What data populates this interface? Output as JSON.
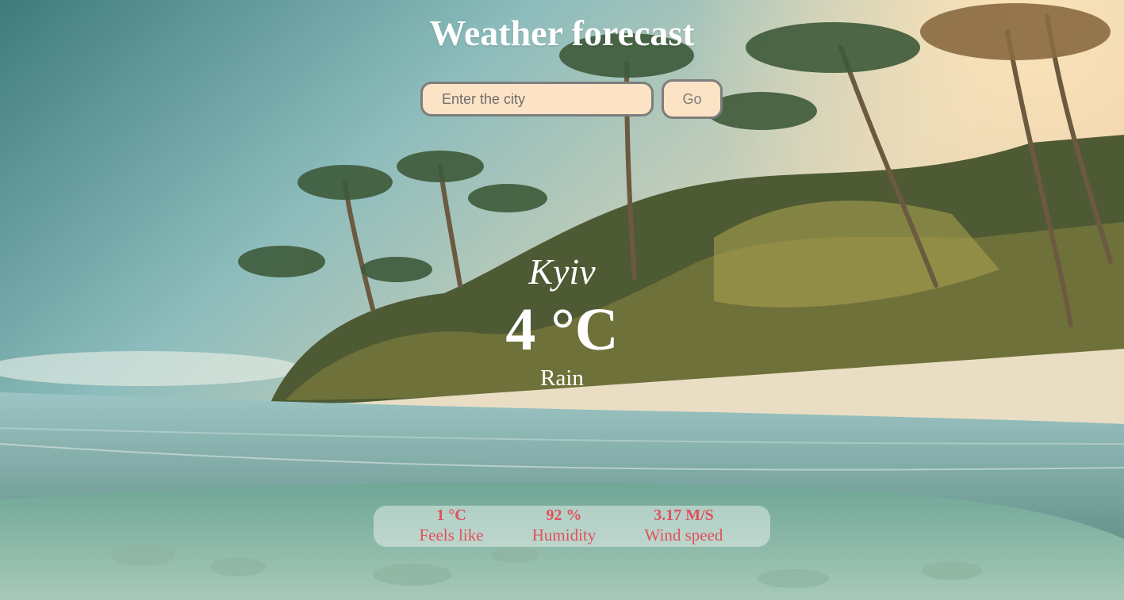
{
  "header": {
    "title": "Weather forecast"
  },
  "search": {
    "placeholder": "Enter the city",
    "value": "",
    "button_label": "Go"
  },
  "current": {
    "city": "Kyiv",
    "temperature": "4 °C",
    "condition": "Rain"
  },
  "details": [
    {
      "value": "1 °C",
      "label": "Feels like"
    },
    {
      "value": "92 %",
      "label": "Humidity"
    },
    {
      "value": "3.17 M/S",
      "label": "Wind speed"
    }
  ],
  "colors": {
    "title_text": "#ffffff",
    "input_bg": "#fde3c6",
    "input_border": "#7d7d7d",
    "details_text": "#e0505a"
  }
}
